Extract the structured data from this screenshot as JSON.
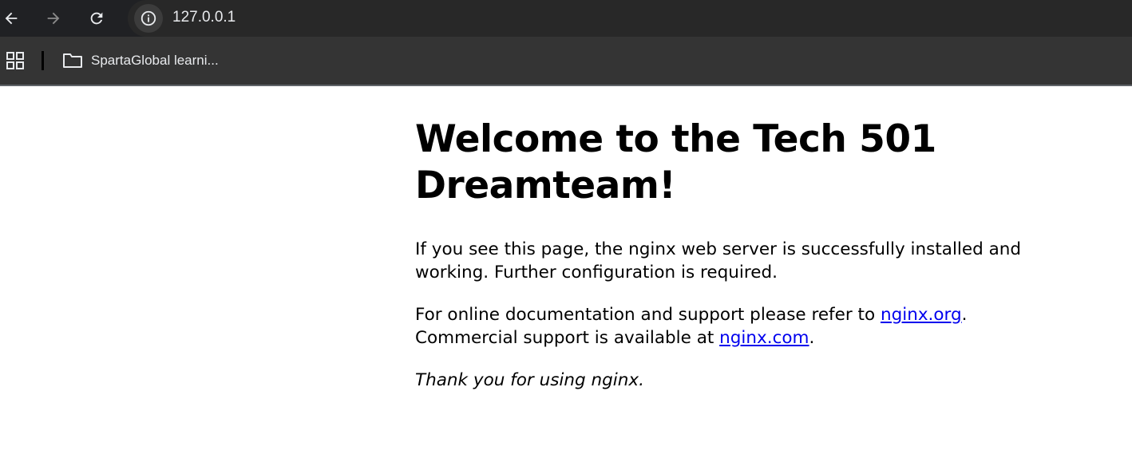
{
  "browser": {
    "url": "127.0.0.1",
    "icons": {
      "back": "arrow-left-icon",
      "forward": "arrow-right-icon",
      "reload": "reload-icon",
      "site_info": "info-icon",
      "apps": "apps-grid-icon",
      "folder": "folder-icon"
    },
    "bookmarks": [
      {
        "label": "SpartaGlobal learni..."
      }
    ]
  },
  "page": {
    "heading": "Welcome to the Tech 501 Dreamteam!",
    "paragraph1": "If you see this page, the nginx web server is successfully installed and working. Further configuration is required.",
    "paragraph2_prefix": "For online documentation and support please refer to ",
    "link_org": "nginx.org",
    "paragraph2_middle": ".",
    "paragraph2_line2": "Commercial support is available at ",
    "link_com": "nginx.com",
    "paragraph2_suffix": ".",
    "paragraph3": "Thank you for using nginx."
  },
  "colors": {
    "toolbar_bg": "#202124",
    "bookmarks_bg": "#343434",
    "link": "#0000ee",
    "text": "#000000"
  }
}
